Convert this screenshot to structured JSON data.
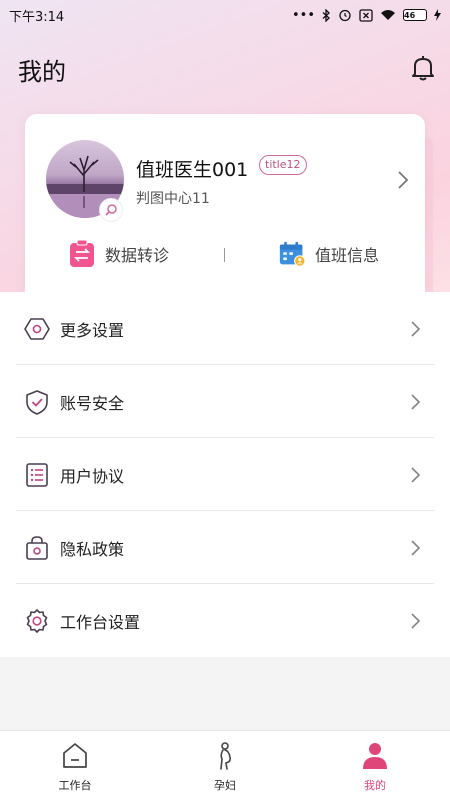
{
  "status_bar": {
    "time": "下午3:14",
    "battery": "46"
  },
  "header": {
    "title": "我的",
    "bell_icon": "bell-icon"
  },
  "profile": {
    "name": "值班医生001",
    "title_tag": "title12",
    "organization": "判图中心11",
    "avatar_icon": "avatar",
    "actions": [
      {
        "label": "数据转诊",
        "icon": "transfer-icon",
        "color": "#f0558f"
      },
      {
        "label": "值班信息",
        "icon": "calendar-icon",
        "color": "#3d8fe0"
      }
    ]
  },
  "menu": {
    "items": [
      {
        "label": "更多设置",
        "icon": "hexagon-settings-icon"
      },
      {
        "label": "账号安全",
        "icon": "shield-check-icon"
      },
      {
        "label": "用户协议",
        "icon": "list-document-icon"
      },
      {
        "label": "隐私政策",
        "icon": "lock-bag-icon"
      },
      {
        "label": "工作台设置",
        "icon": "gear-icon"
      }
    ]
  },
  "tabbar": {
    "tabs": [
      {
        "label": "工作台",
        "icon": "workbench-icon",
        "active": false
      },
      {
        "label": "孕妇",
        "icon": "pregnant-icon",
        "active": false
      },
      {
        "label": "我的",
        "icon": "person-icon",
        "active": true
      }
    ],
    "active_color": "#e0457a"
  },
  "colors": {
    "accent": "#e0457a",
    "menu_icon": "#8a3a72"
  }
}
